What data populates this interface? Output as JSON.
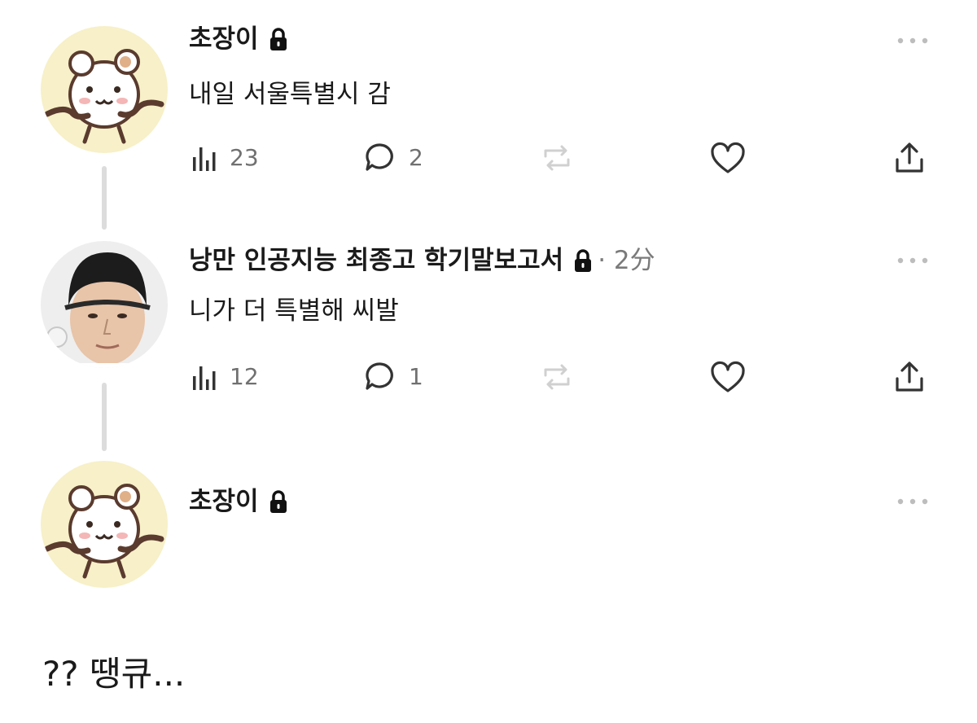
{
  "posts": [
    {
      "author": "초장이",
      "time": "",
      "text": "내일 서울특별시 감",
      "views": "23",
      "replies": "2"
    },
    {
      "author": "낭만 인공지능 최종고 학기말보고서",
      "time": "· 2分",
      "text": "니가 더 특별해 씨발",
      "views": "12",
      "replies": "1"
    },
    {
      "author": "초장이",
      "time": "",
      "text": "",
      "views": "",
      "replies": ""
    }
  ],
  "caption": "?? 땡큐...",
  "icons": {
    "lock": "lock-icon",
    "more": "more-icon",
    "views": "bar-chart-icon",
    "reply": "speech-bubble-icon",
    "repost": "repost-icon",
    "like": "heart-icon",
    "share": "share-icon"
  },
  "colors": {
    "text": "#1a1a1a",
    "muted": "#707070",
    "icon": "#333333",
    "repost_disabled": "#d0d0d0",
    "thread_line": "#dcdcdc",
    "hamster_bg": "#f7f0c8"
  }
}
